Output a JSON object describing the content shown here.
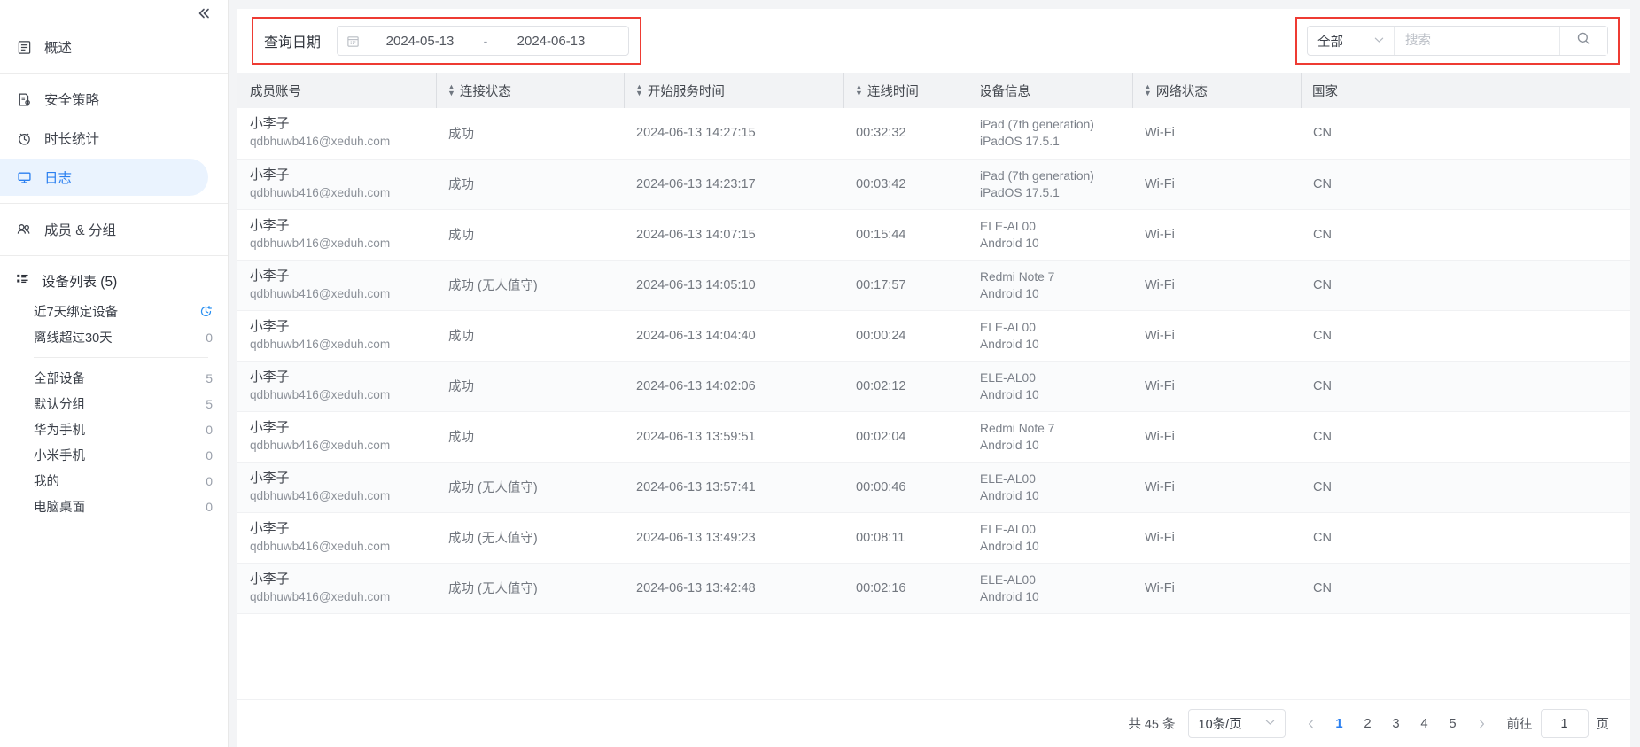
{
  "sidebar": {
    "collapse_icon": "double-chevron-left-icon",
    "nav_groups": [
      {
        "items": [
          {
            "label": "概述",
            "icon": "document-icon",
            "active": false
          }
        ]
      },
      {
        "items": [
          {
            "label": "安全策略",
            "icon": "policy-icon",
            "active": false
          },
          {
            "label": "时长统计",
            "icon": "clock-icon",
            "active": false
          },
          {
            "label": "日志",
            "icon": "monitor-icon",
            "active": true
          }
        ]
      },
      {
        "items": [
          {
            "label": "成员 & 分组",
            "icon": "users-icon",
            "active": false
          }
        ]
      }
    ],
    "device_list": {
      "title": "设备列表 (5)",
      "icon": "list-icon",
      "top_rows": [
        {
          "label": "近7天绑定设备",
          "count": "",
          "icon": "history-clock-icon"
        },
        {
          "label": "离线超过30天",
          "count": "0",
          "icon": ""
        }
      ],
      "group_rows": [
        {
          "label": "全部设备",
          "count": "5"
        },
        {
          "label": "默认分组",
          "count": "5"
        },
        {
          "label": "华为手机",
          "count": "0"
        },
        {
          "label": "小米手机",
          "count": "0"
        },
        {
          "label": "我的",
          "count": "0"
        },
        {
          "label": "电脑桌面",
          "count": "0"
        }
      ]
    }
  },
  "toolbar": {
    "date_label": "查询日期",
    "date_icon": "calendar-icon",
    "date_start": "2024-05-13",
    "date_separator": "-",
    "date_end": "2024-06-13",
    "filter_select_value": "全部",
    "filter_chevron": "chevron-down-icon",
    "search_placeholder": "搜索",
    "search_value": "",
    "search_button_icon": "search-icon"
  },
  "table": {
    "columns": [
      {
        "label": "成员账号",
        "sortable": false,
        "divider": false
      },
      {
        "label": "连接状态",
        "sortable": true,
        "divider": true
      },
      {
        "label": "开始服务时间",
        "sortable": true,
        "divider": true
      },
      {
        "label": "连线时间",
        "sortable": true,
        "divider": true
      },
      {
        "label": "设备信息",
        "sortable": false,
        "divider": true
      },
      {
        "label": "网络状态",
        "sortable": true,
        "divider": true
      },
      {
        "label": "国家",
        "sortable": false,
        "divider": true
      }
    ],
    "rows": [
      {
        "name": "小李子",
        "email": "qdbhuwb416@xeduh.com",
        "status": "成功",
        "start_time": "2024-06-13 14:27:15",
        "duration": "00:32:32",
        "device_model": "iPad (7th generation)",
        "device_os": "iPadOS 17.5.1",
        "network": "Wi-Fi",
        "country": "CN"
      },
      {
        "name": "小李子",
        "email": "qdbhuwb416@xeduh.com",
        "status": "成功",
        "start_time": "2024-06-13 14:23:17",
        "duration": "00:03:42",
        "device_model": "iPad (7th generation)",
        "device_os": "iPadOS 17.5.1",
        "network": "Wi-Fi",
        "country": "CN"
      },
      {
        "name": "小李子",
        "email": "qdbhuwb416@xeduh.com",
        "status": "成功",
        "start_time": "2024-06-13 14:07:15",
        "duration": "00:15:44",
        "device_model": "ELE-AL00",
        "device_os": "Android 10",
        "network": "Wi-Fi",
        "country": "CN"
      },
      {
        "name": "小李子",
        "email": "qdbhuwb416@xeduh.com",
        "status": "成功 (无人值守)",
        "start_time": "2024-06-13 14:05:10",
        "duration": "00:17:57",
        "device_model": "Redmi Note 7",
        "device_os": "Android 10",
        "network": "Wi-Fi",
        "country": "CN"
      },
      {
        "name": "小李子",
        "email": "qdbhuwb416@xeduh.com",
        "status": "成功",
        "start_time": "2024-06-13 14:04:40",
        "duration": "00:00:24",
        "device_model": "ELE-AL00",
        "device_os": "Android 10",
        "network": "Wi-Fi",
        "country": "CN"
      },
      {
        "name": "小李子",
        "email": "qdbhuwb416@xeduh.com",
        "status": "成功",
        "start_time": "2024-06-13 14:02:06",
        "duration": "00:02:12",
        "device_model": "ELE-AL00",
        "device_os": "Android 10",
        "network": "Wi-Fi",
        "country": "CN"
      },
      {
        "name": "小李子",
        "email": "qdbhuwb416@xeduh.com",
        "status": "成功",
        "start_time": "2024-06-13 13:59:51",
        "duration": "00:02:04",
        "device_model": "Redmi Note 7",
        "device_os": "Android 10",
        "network": "Wi-Fi",
        "country": "CN"
      },
      {
        "name": "小李子",
        "email": "qdbhuwb416@xeduh.com",
        "status": "成功 (无人值守)",
        "start_time": "2024-06-13 13:57:41",
        "duration": "00:00:46",
        "device_model": "ELE-AL00",
        "device_os": "Android 10",
        "network": "Wi-Fi",
        "country": "CN"
      },
      {
        "name": "小李子",
        "email": "qdbhuwb416@xeduh.com",
        "status": "成功 (无人值守)",
        "start_time": "2024-06-13 13:49:23",
        "duration": "00:08:11",
        "device_model": "ELE-AL00",
        "device_os": "Android 10",
        "network": "Wi-Fi",
        "country": "CN"
      },
      {
        "name": "小李子",
        "email": "qdbhuwb416@xeduh.com",
        "status": "成功 (无人值守)",
        "start_time": "2024-06-13 13:42:48",
        "duration": "00:02:16",
        "device_model": "ELE-AL00",
        "device_os": "Android 10",
        "network": "Wi-Fi",
        "country": "CN"
      }
    ]
  },
  "pagination": {
    "total_text": "共 45 条",
    "page_size": "10条/页",
    "prev_icon": "chevron-left-icon",
    "next_icon": "chevron-right-icon",
    "pages": [
      "1",
      "2",
      "3",
      "4",
      "5"
    ],
    "current_page": "1",
    "jump_label": "前往",
    "jump_value": "1",
    "jump_suffix": "页"
  },
  "colors": {
    "accent": "#2a7ff0",
    "highlight_border": "#ee3b33",
    "active_bg": "#eaf3fe",
    "header_bg": "#f2f3f5"
  }
}
